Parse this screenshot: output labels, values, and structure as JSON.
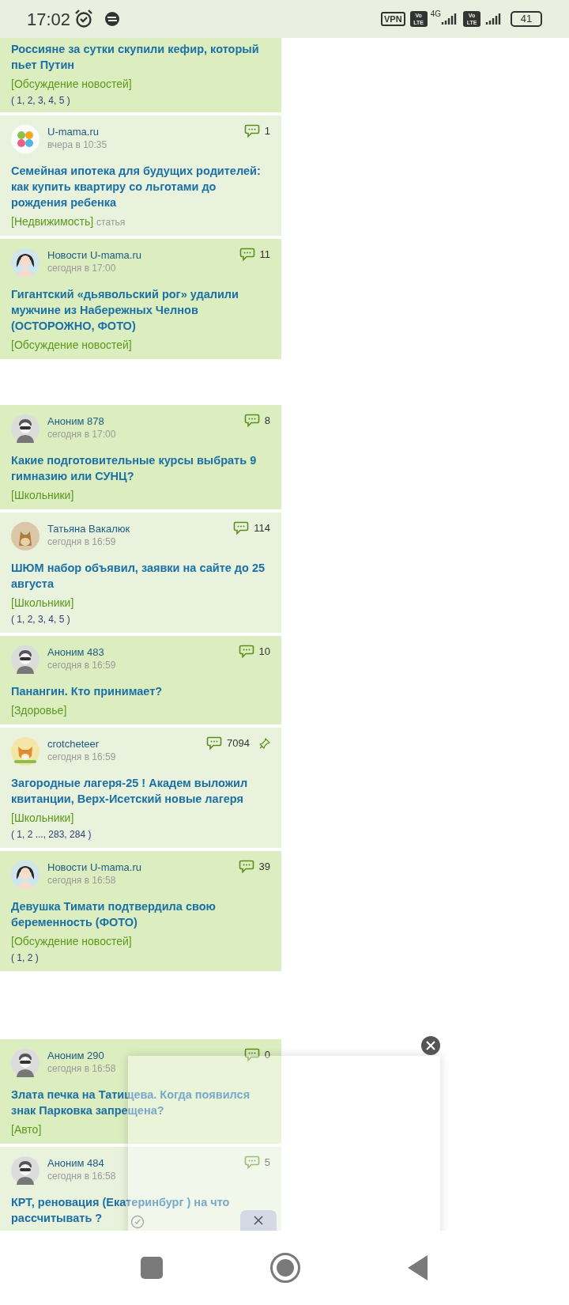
{
  "status_bar": {
    "time": "17:02",
    "vpn": "VPN",
    "volte_1": "Vo LTE",
    "network": "4G",
    "volte_2": "Vo LTE",
    "battery": "41"
  },
  "top_fragment": {
    "title": "Россияне за сутки скупили кефир, который пьет Путин",
    "category": "[Обсуждение новостей]",
    "pages": "( 1, 2, 3, 4, 5 )"
  },
  "feed": [
    {
      "kind": "topic",
      "avatar": {
        "kind": "logo"
      },
      "author": "U-mama.ru",
      "time": "вчера в 10:35",
      "comments": "1",
      "pinned": false,
      "title": "Семейная ипотека для будущих родителей: как купить квартиру со льготами до рождения ребенка",
      "category": "[Недвижимость]",
      "note": "статья"
    },
    {
      "kind": "topic",
      "avatar": {
        "kind": "woman"
      },
      "author": "Новости U-mama.ru",
      "time": "сегодня в 17:00",
      "comments": "11",
      "pinned": false,
      "title": "Гигантский «дьявольский рог» удалили мужчине из Набережных Челнов (ОСТОРОЖНО, ФОТО)",
      "category": "[Обсуждение новостей]"
    },
    {
      "kind": "blank"
    },
    {
      "kind": "topic",
      "avatar": {
        "kind": "anon"
      },
      "author": "Аноним 878",
      "time": "сегодня в 17:00",
      "comments": "8",
      "pinned": false,
      "title": "Какие подготовительные курсы выбрать 9 гимназию или СУНЦ?",
      "category": "[Школьники]"
    },
    {
      "kind": "topic",
      "avatar": {
        "kind": "cat"
      },
      "author": "Татьяна Вакалюк",
      "time": "сегодня в 16:59",
      "comments": "114",
      "pinned": false,
      "title": "ШЮМ набор объявил, заявки на сайте до 25 августа",
      "category": "[Школьники]",
      "pages": "( 1, 2, 3, 4, 5 )"
    },
    {
      "kind": "topic",
      "avatar": {
        "kind": "anon"
      },
      "author": "Аноним 483",
      "time": "сегодня в 16:59",
      "comments": "10",
      "pinned": false,
      "title": "Панангин. Кто принимает?",
      "category": "[Здоровье]"
    },
    {
      "kind": "topic",
      "avatar": {
        "kind": "fox"
      },
      "author": "crotcheteer",
      "time": "сегодня в 16:59",
      "comments": "7094",
      "pinned": true,
      "title": "Загородные лагеря-25 ! Академ выложил квитанции, Верх-Исетский новые лагеря",
      "category": "[Школьники]",
      "pages": "( 1, 2 ..., 283, 284 )"
    },
    {
      "kind": "topic",
      "avatar": {
        "kind": "woman"
      },
      "author": "Новости U-mama.ru",
      "time": "сегодня в 16:58",
      "comments": "39",
      "pinned": false,
      "title": "Девушка Тимати подтвердила свою беременность (ФОТО)",
      "category": "[Обсуждение новостей]",
      "pages": "( 1, 2 )"
    },
    {
      "kind": "blank"
    },
    {
      "kind": "topic",
      "avatar": {
        "kind": "anon"
      },
      "author": "Аноним 290",
      "time": "сегодня в 16:58",
      "comments": "0",
      "pinned": false,
      "title": "Злата печка на Татищева. Когда появился знак Парковка запрещена?",
      "category": "[Авто]"
    },
    {
      "kind": "topic",
      "avatar": {
        "kind": "anon"
      },
      "author": "Аноним 484",
      "time": "сегодня в 16:58",
      "comments": "5",
      "pinned": false,
      "title": "КРТ, реновация (Екатеринбург ) на что рассчитывать ?"
    }
  ]
}
